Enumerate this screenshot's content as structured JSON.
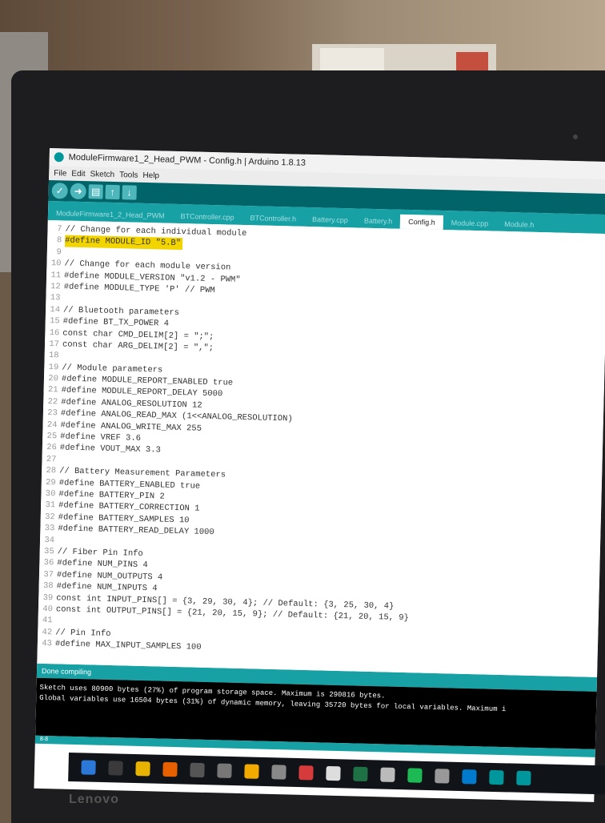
{
  "window": {
    "title": "ModuleFirmware1_2_Head_PWM - Config.h | Arduino 1.8.13"
  },
  "menu": [
    "File",
    "Edit",
    "Sketch",
    "Tools",
    "Help"
  ],
  "tabs": [
    "ModuleFirmware1_2_Head_PWM",
    "BTController.cpp",
    "BTController.h",
    "Battery.cpp",
    "Battery.h",
    "Config.h",
    "Module.cpp",
    "Module.h"
  ],
  "active_tab": "Config.h",
  "code_lines": [
    {
      "n": "7",
      "t": "// Change for each individual module"
    },
    {
      "n": "8",
      "t": "#define MODULE_ID \"5.B\""
    },
    {
      "n": "9",
      "t": ""
    },
    {
      "n": "10",
      "t": "// Change for each module version"
    },
    {
      "n": "11",
      "t": "#define MODULE_VERSION \"v1.2 - PWM\""
    },
    {
      "n": "12",
      "t": "#define MODULE_TYPE 'P' // PWM"
    },
    {
      "n": "13",
      "t": ""
    },
    {
      "n": "14",
      "t": "// Bluetooth parameters"
    },
    {
      "n": "15",
      "t": "#define BT_TX_POWER 4"
    },
    {
      "n": "16",
      "t": "const char CMD_DELIM[2] = \";\";"
    },
    {
      "n": "17",
      "t": "const char ARG_DELIM[2] = \",\";"
    },
    {
      "n": "18",
      "t": ""
    },
    {
      "n": "19",
      "t": "// Module parameters"
    },
    {
      "n": "20",
      "t": "#define MODULE_REPORT_ENABLED true"
    },
    {
      "n": "21",
      "t": "#define MODULE_REPORT_DELAY 5000"
    },
    {
      "n": "22",
      "t": "#define ANALOG_RESOLUTION 12"
    },
    {
      "n": "23",
      "t": "#define ANALOG_READ_MAX (1<<ANALOG_RESOLUTION)"
    },
    {
      "n": "24",
      "t": "#define ANALOG_WRITE_MAX 255"
    },
    {
      "n": "25",
      "t": "#define VREF 3.6"
    },
    {
      "n": "26",
      "t": "#define VOUT_MAX 3.3"
    },
    {
      "n": "27",
      "t": ""
    },
    {
      "n": "28",
      "t": "// Battery Measurement Parameters"
    },
    {
      "n": "29",
      "t": "#define BATTERY_ENABLED true"
    },
    {
      "n": "30",
      "t": "#define BATTERY_PIN 2"
    },
    {
      "n": "31",
      "t": "#define BATTERY_CORRECTION 1"
    },
    {
      "n": "32",
      "t": "#define BATTERY_SAMPLES 10"
    },
    {
      "n": "33",
      "t": "#define BATTERY_READ_DELAY 1000"
    },
    {
      "n": "34",
      "t": ""
    },
    {
      "n": "35",
      "t": "// Fiber Pin Info"
    },
    {
      "n": "36",
      "t": "#define NUM_PINS 4"
    },
    {
      "n": "37",
      "t": "#define NUM_OUTPUTS 4"
    },
    {
      "n": "38",
      "t": "#define NUM_INPUTS 4"
    },
    {
      "n": "39",
      "t": "const int INPUT_PINS[] = {3, 29, 30, 4}; // Default: {3, 25, 30, 4}"
    },
    {
      "n": "40",
      "t": "const int OUTPUT_PINS[] = {21, 20, 15, 9}; // Default: {21, 20, 15, 9}"
    },
    {
      "n": "41",
      "t": ""
    },
    {
      "n": "42",
      "t": "// Pin Info"
    },
    {
      "n": "43",
      "t": "#define MAX_INPUT_SAMPLES 100"
    }
  ],
  "status": "Done compiling",
  "console": [
    "Sketch uses 80900 bytes (27%) of program storage space. Maximum is 290816 bytes.",
    "Global variables use 16504 bytes (31%) of dynamic memory, leaving 35720 bytes for local variables. Maximum i"
  ],
  "bottom_line": "8-8",
  "brand": "Lenovo"
}
